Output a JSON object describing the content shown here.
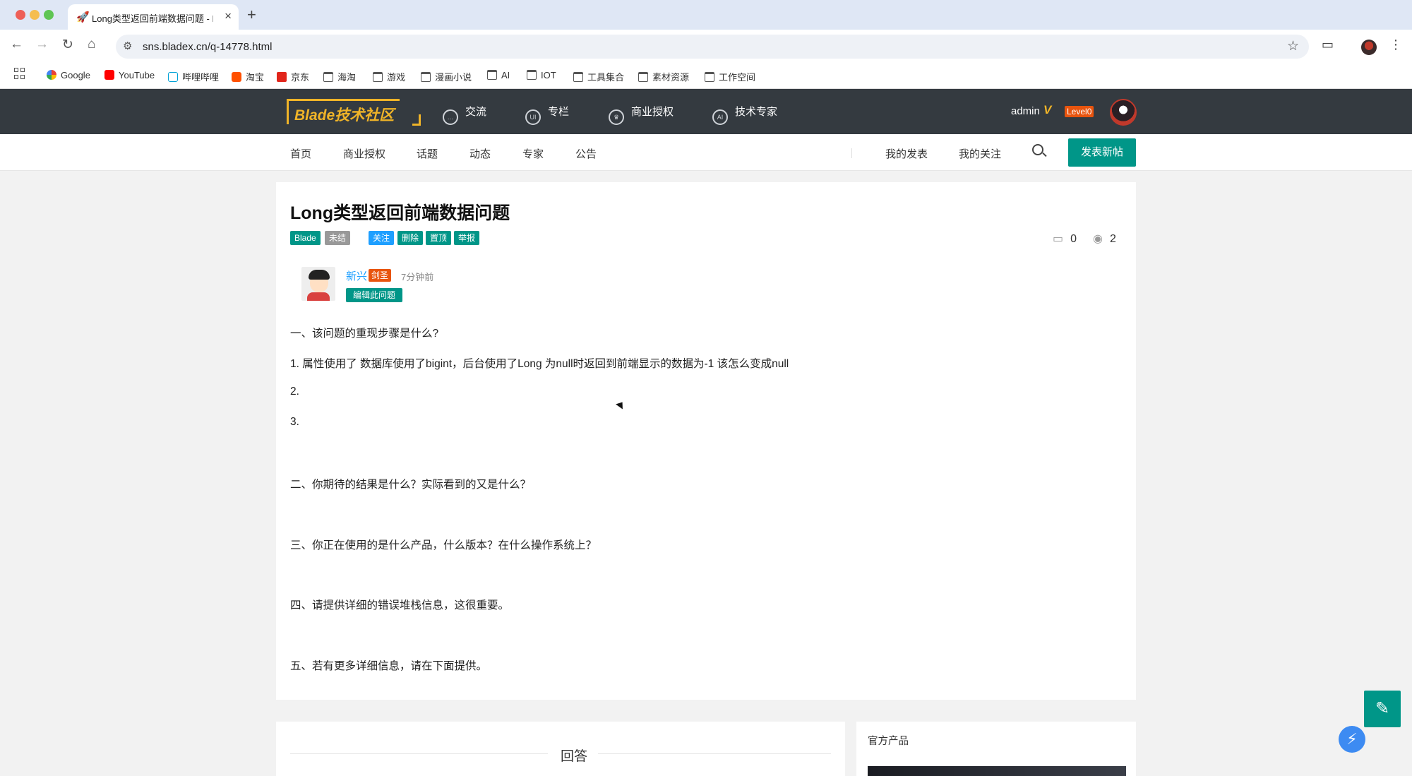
{
  "browser": {
    "tab_title": "Long类型返回前端数据问题 - Bl",
    "tab_icon": "🚀",
    "url": "sns.bladex.cn/q-14778.html",
    "bookmarks": [
      {
        "label": "Google",
        "icon": "google"
      },
      {
        "label": "YouTube",
        "icon": "youtube"
      },
      {
        "label": "哔哩哔哩",
        "icon": "bilibili"
      },
      {
        "label": "淘宝",
        "icon": "taobao"
      },
      {
        "label": "京东",
        "icon": "jd"
      },
      {
        "label": "海淘",
        "icon": "folder"
      },
      {
        "label": "游戏",
        "icon": "folder"
      },
      {
        "label": "漫画小说",
        "icon": "folder"
      },
      {
        "label": "AI",
        "icon": "folder"
      },
      {
        "label": "IOT",
        "icon": "folder"
      },
      {
        "label": "工具集合",
        "icon": "folder"
      },
      {
        "label": "素材资源",
        "icon": "folder"
      },
      {
        "label": "工作空间",
        "icon": "folder"
      }
    ]
  },
  "site": {
    "logo": "Blade技术社区",
    "top_nav": [
      "交流",
      "专栏",
      "商业授权",
      "技术专家"
    ],
    "top_nav_icons": [
      "chat-icon",
      "ui-icon",
      "crown-icon",
      "ai-icon"
    ],
    "user": {
      "name": "admin",
      "vip_mark": "V",
      "level": "Level0"
    },
    "sub_nav": [
      "首页",
      "商业授权",
      "话题",
      "动态",
      "专家",
      "公告"
    ],
    "my_posts": "我的发表",
    "my_follows": "我的关注",
    "post_button": "发表新帖"
  },
  "question": {
    "title": "Long类型返回前端数据问题",
    "tags": [
      "Blade",
      "未结"
    ],
    "actions": [
      "关注",
      "删除",
      "置顶",
      "举报"
    ],
    "comment_count": "0",
    "view_count": "2",
    "author": {
      "name": "新兴",
      "rank": "剑圣",
      "time": "7分钟前",
      "edit_label": "编辑此问题"
    },
    "body": [
      "一、该问题的重现步骤是什么?",
      "1. 属性使用了  数据库使用了bigint，后台使用了Long 为null时返回到前端显示的数据为-1 该怎么变成null",
      "2.",
      "3.",
      "二、你期待的结果是什么？实际看到的又是什么？",
      "三、你正在使用的是什么产品，什么版本？在什么操作系统上？",
      "四、请提供详细的错误堆栈信息，这很重要。",
      "五、若有更多详细信息，请在下面提供。"
    ]
  },
  "answers": {
    "title": "回答"
  },
  "sidebar": {
    "products_title": "官方产品"
  },
  "colors": {
    "accent": "#009688",
    "header_bg": "#343a40",
    "logo": "#f0b428",
    "badge": "#e8540e",
    "link": "#1e9fff"
  }
}
